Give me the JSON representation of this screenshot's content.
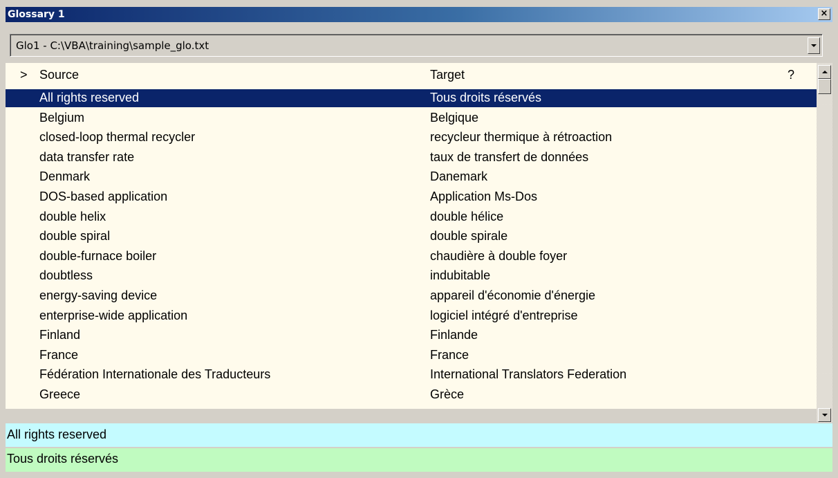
{
  "window": {
    "title": "Glossary 1",
    "close_label": "×"
  },
  "glossary_selector": {
    "value": "Glo1 - C:\\VBA\\training\\sample_glo.txt"
  },
  "grid": {
    "columns": {
      "marker": ">",
      "source": "Source",
      "target": "Target",
      "flag": "?"
    },
    "selected_index": 0,
    "rows": [
      {
        "source": "All rights reserved",
        "target": "Tous droits réservés"
      },
      {
        "source": "Belgium",
        "target": "Belgique"
      },
      {
        "source": "closed-loop thermal recycler",
        "target": "recycleur thermique à rétroaction"
      },
      {
        "source": "data transfer rate",
        "target": "taux de transfert de données"
      },
      {
        "source": "Denmark",
        "target": "Danemark"
      },
      {
        "source": "DOS-based application",
        "target": "Application Ms-Dos"
      },
      {
        "source": "double helix",
        "target": "double hélice"
      },
      {
        "source": "double spiral",
        "target": "double spirale"
      },
      {
        "source": "double-furnace boiler",
        "target": "chaudière à double foyer"
      },
      {
        "source": "doubtless",
        "target": "indubitable"
      },
      {
        "source": "energy-saving device",
        "target": "appareil d'économie d'énergie"
      },
      {
        "source": "enterprise-wide application",
        "target": "logiciel intégré d'entreprise"
      },
      {
        "source": "Finland",
        "target": "Finlande"
      },
      {
        "source": "France",
        "target": "France"
      },
      {
        "source": "Fédération Internationale des Traducteurs",
        "target": "International Translators Federation"
      },
      {
        "source": "Greece",
        "target": "Grèce"
      }
    ]
  },
  "detail": {
    "source_text": "All rights reserved",
    "target_text": "Tous droits réservés"
  },
  "colors": {
    "title_gradient_start": "#0a246a",
    "title_gradient_end": "#a6caf0",
    "grid_background": "#fffbec",
    "selection": "#0a246a",
    "detail_source_bg": "#c4fbff",
    "detail_target_bg": "#c0fbc0"
  }
}
